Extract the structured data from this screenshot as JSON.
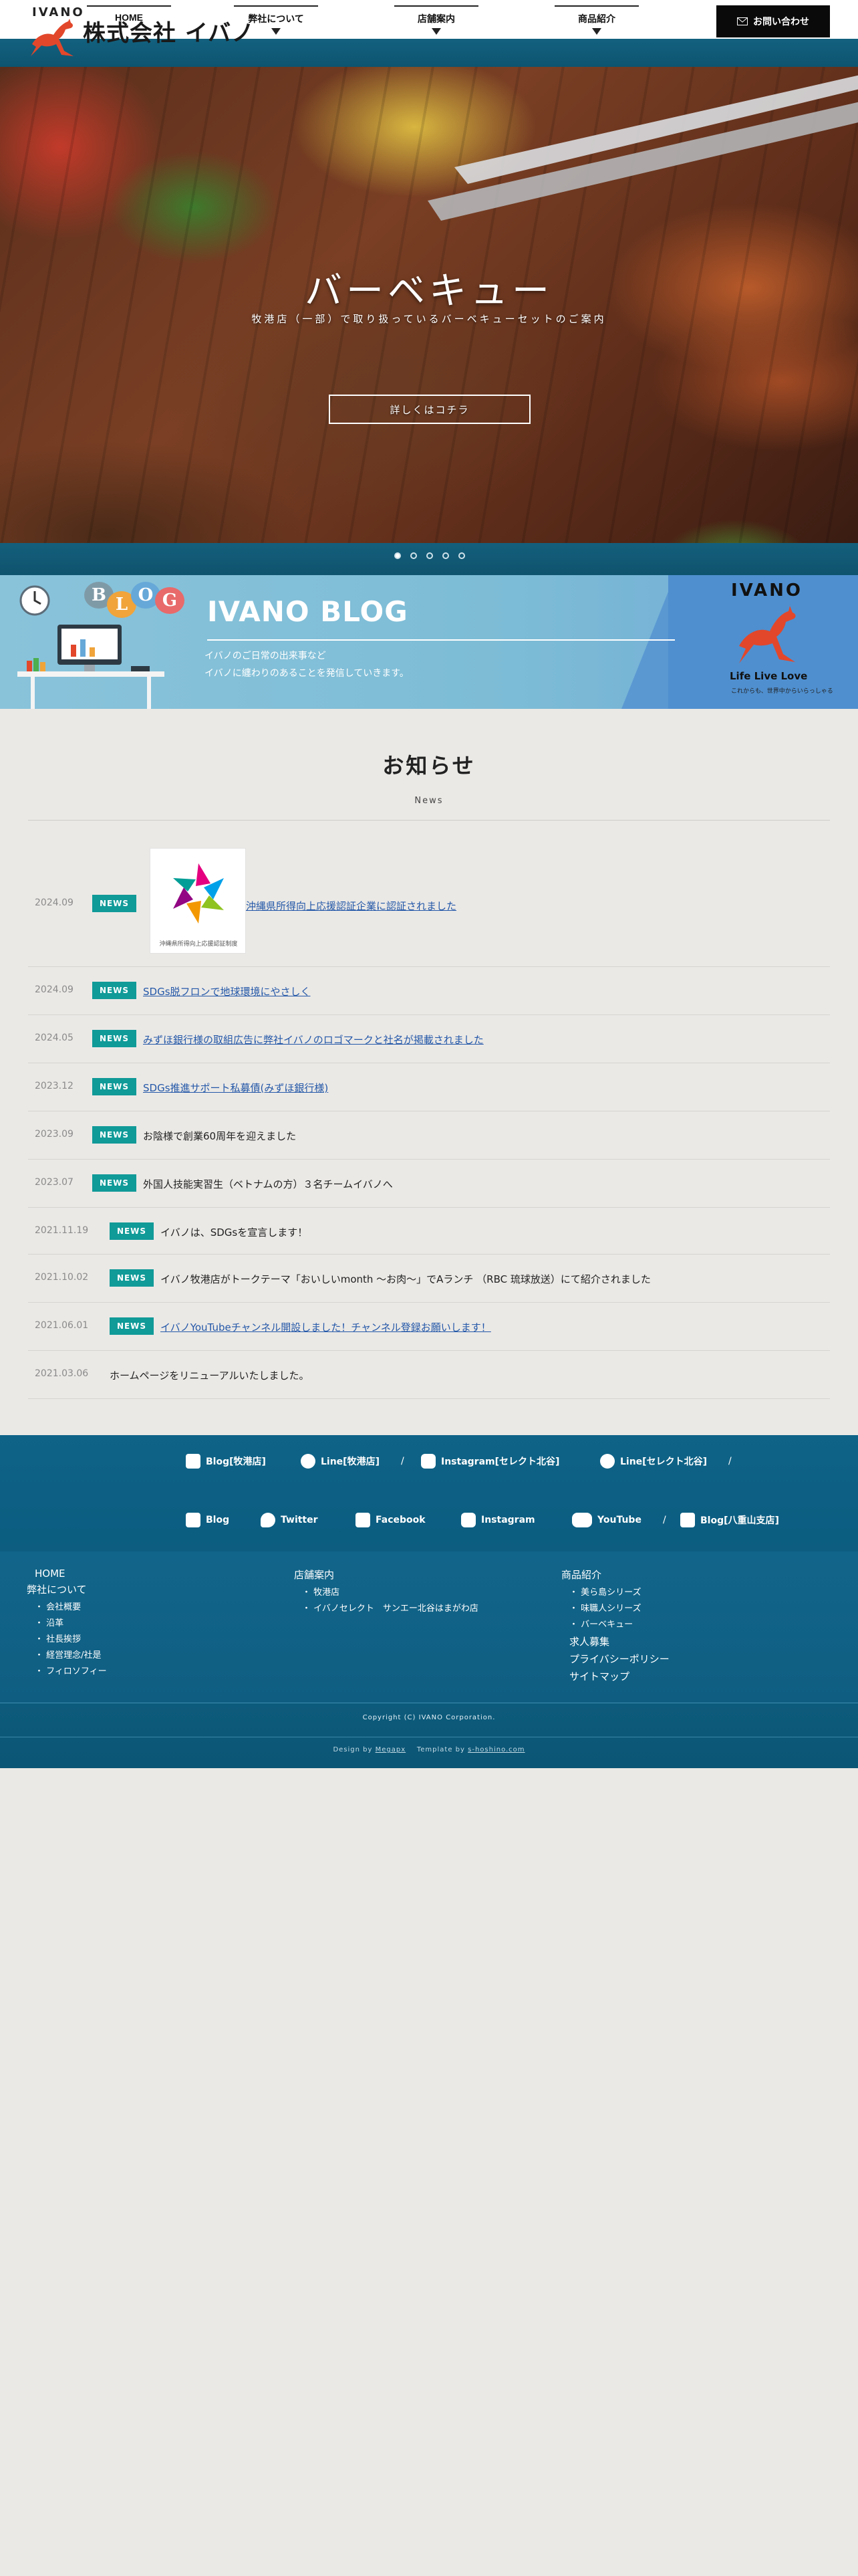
{
  "header": {
    "brand": "IVANO",
    "company": "株式会社 イバノ",
    "nav": [
      {
        "label": "HOME"
      },
      {
        "label": "弊社について"
      },
      {
        "label": "店舗案内"
      },
      {
        "label": "商品紹介"
      }
    ],
    "contact_label": "お問い合わせ"
  },
  "hero": {
    "title": "バーベキュー",
    "subtitle": "牧港店（一部）で取り扱っているバーベキューセットのご案内",
    "button_label": "詳しくはコチラ",
    "slides": 5,
    "active_slide": 1
  },
  "blog_banner": {
    "bubble_letters": [
      "B",
      "L",
      "O",
      "G"
    ],
    "title": "IVANO BLOG",
    "desc_line1": "イバノのご日常の出来事など",
    "desc_line2": "イバノに纏わりのあることを発信していきます。",
    "badge_brand": "IVANO",
    "badge_tagline": "Life Live Love",
    "badge_small": "これからも、世界中からいらっしゃる"
  },
  "news": {
    "heading": "お知らせ",
    "sub": "News",
    "thumb_caption": "沖縄県所得向上応援認証制度",
    "items": [
      {
        "date": "2024.09",
        "badge": "NEWS",
        "text": "沖縄県所得向上応援認証企業に認証されました",
        "link": true
      },
      {
        "date": "2024.09",
        "badge": "NEWS",
        "text": "SDGs脱フロンで地球環境にやさしく",
        "link": true
      },
      {
        "date": "2024.05",
        "badge": "NEWS",
        "text": "みずほ銀行様の取組広告に弊社イバノのロゴマークと社名が掲載されました",
        "link": true
      },
      {
        "date": "2023.12",
        "badge": "NEWS",
        "text": "SDGs推進サポート私募債(みずほ銀行様)",
        "link": true
      },
      {
        "date": "2023.09",
        "badge": "NEWS",
        "text": "お陰様で創業60周年を迎えました",
        "link": false
      },
      {
        "date": "2023.07",
        "badge": "NEWS",
        "text": "外国人技能実習生（ベトナムの方）３名チームイバノへ",
        "link": false
      },
      {
        "date": "2021.11.19",
        "badge": "NEWS",
        "text": "イバノは、SDGsを宣言します！",
        "link": false
      },
      {
        "date": "2021.10.02",
        "badge": "NEWS",
        "text": "イバノ牧港店がトークテーマ「おいしいmonth ～お肉～」でAランチ （RBC 琉球放送）にて紹介されました",
        "link": false
      },
      {
        "date": "2021.06.01",
        "badge": "NEWS",
        "text": "イバノYouTubeチャンネル開設しました！チャンネル登録お願いします！",
        "link": true
      },
      {
        "date": "2021.03.06",
        "badge": "",
        "text": "ホームページをリニューアルいたしました。",
        "link": false
      }
    ]
  },
  "footer": {
    "social_row1": [
      {
        "label": "Blog[牧港店]",
        "icon": "blog-icon"
      },
      {
        "label": "Line[牧港店]",
        "icon": "line-icon"
      },
      {
        "label": "Instagram[セレクト北谷]",
        "icon": "instagram-icon"
      },
      {
        "label": "Line[セレクト北谷]",
        "icon": "line-icon"
      }
    ],
    "social_row2": [
      {
        "label": "Blog",
        "icon": "blog-icon"
      },
      {
        "label": "Twitter",
        "icon": "twitter-icon"
      },
      {
        "label": "Facebook",
        "icon": "facebook-icon"
      },
      {
        "label": "Instagram",
        "icon": "instagram-icon"
      },
      {
        "label": "YouTube",
        "icon": "youtube-icon"
      },
      {
        "label": "Blog[八重山支店]",
        "icon": "blog-icon"
      }
    ],
    "col1": {
      "home": "HOME",
      "about": "弊社について",
      "items": [
        "会社概要",
        "沿革",
        "社長挨拶",
        "経営理念/社是",
        "フィロソフィー"
      ]
    },
    "col2": {
      "title": "店舗案内",
      "items": [
        "牧港店",
        "イバノセレクト　サンエー北谷はまがわ店"
      ]
    },
    "col3": {
      "title": "商品紹介",
      "items": [
        "美ら島シリーズ",
        "味職人シリーズ",
        "バーベキュー"
      ],
      "recruit": "求人募集",
      "privacy": "プライバシーポリシー",
      "sitemap": "サイトマップ"
    },
    "copyright": "Copyright (C) IVANO Corporation.",
    "design_by_prefix": "Design by",
    "design_by_name": "Megapx",
    "template_by_prefix": "Template by",
    "template_by_name": "s-hoshino.com"
  }
}
